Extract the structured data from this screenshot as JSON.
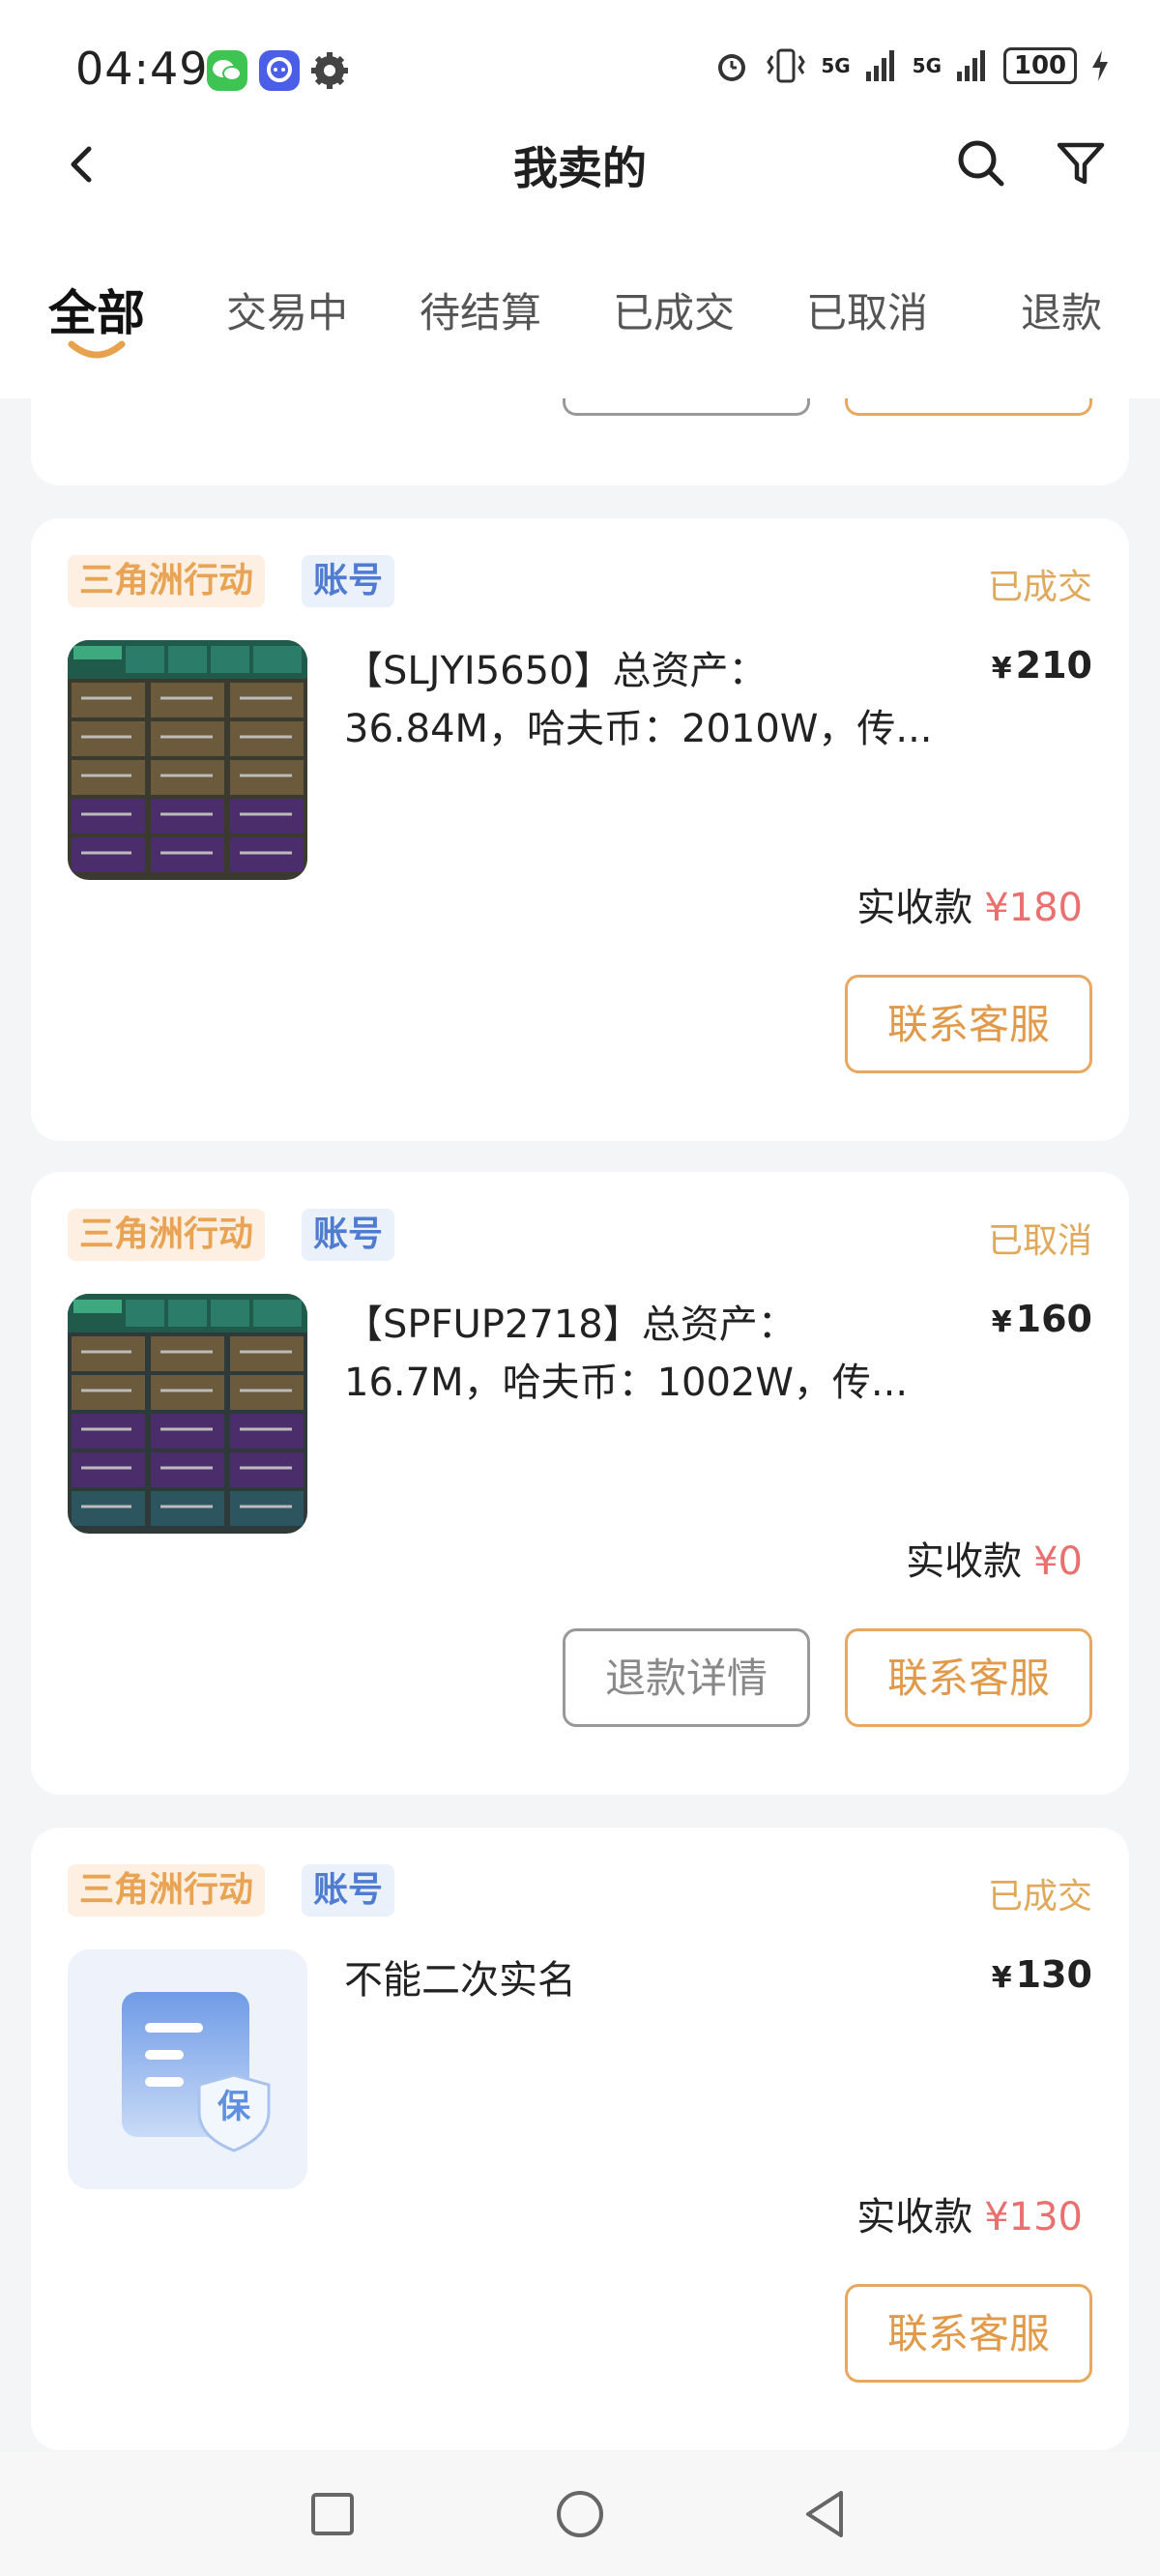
{
  "status_bar": {
    "time": "04:49",
    "battery": "100",
    "network_1": "5G",
    "network_2": "5G",
    "icons": [
      "wechat-icon",
      "chat-app-icon",
      "settings-icon",
      "alarm-icon",
      "vibrate-icon",
      "signal-icon",
      "battery-icon",
      "charging-icon"
    ]
  },
  "header": {
    "title": "我卖的",
    "back_icon": "chevron-left-icon",
    "search_icon": "search-icon",
    "filter_icon": "filter-icon"
  },
  "tabs": [
    {
      "label": "全部",
      "active": true
    },
    {
      "label": "交易中",
      "active": false
    },
    {
      "label": "待结算",
      "active": false
    },
    {
      "label": "已成交",
      "active": false
    },
    {
      "label": "已取消",
      "active": false
    },
    {
      "label": "退款",
      "active": false
    }
  ],
  "orders": [
    {
      "game_tag": "三角洲行动",
      "type_tag": "账号",
      "status": "已成交",
      "title_line1": "【SLJYI5650】总资产：",
      "title_line2": "36.84M，哈夫币：2010W，传...",
      "price_symbol": "¥",
      "price": "210",
      "received_label": "实收款",
      "received_amount": "¥180",
      "primary_button": "联系客服"
    },
    {
      "game_tag": "三角洲行动",
      "type_tag": "账号",
      "status": "已取消",
      "title_line1": "【SPFUP2718】总资产：",
      "title_line2": "16.7M，哈夫币：1002W，传...",
      "price_symbol": "¥",
      "price": "160",
      "received_label": "实收款",
      "received_amount": "¥0",
      "secondary_button": "退款详情",
      "primary_button": "联系客服"
    },
    {
      "game_tag": "三角洲行动",
      "type_tag": "账号",
      "status": "已成交",
      "title_line1": "不能二次实名",
      "price_symbol": "¥",
      "price": "130",
      "received_label": "实收款",
      "received_amount": "¥130",
      "primary_button": "联系客服",
      "thumb_badge": "保"
    }
  ],
  "colors": {
    "accent_orange": "#e09a4a",
    "tag_blue": "#4f7bd0",
    "amount_red": "#ea6f6f",
    "background": "#f4f5f7"
  }
}
